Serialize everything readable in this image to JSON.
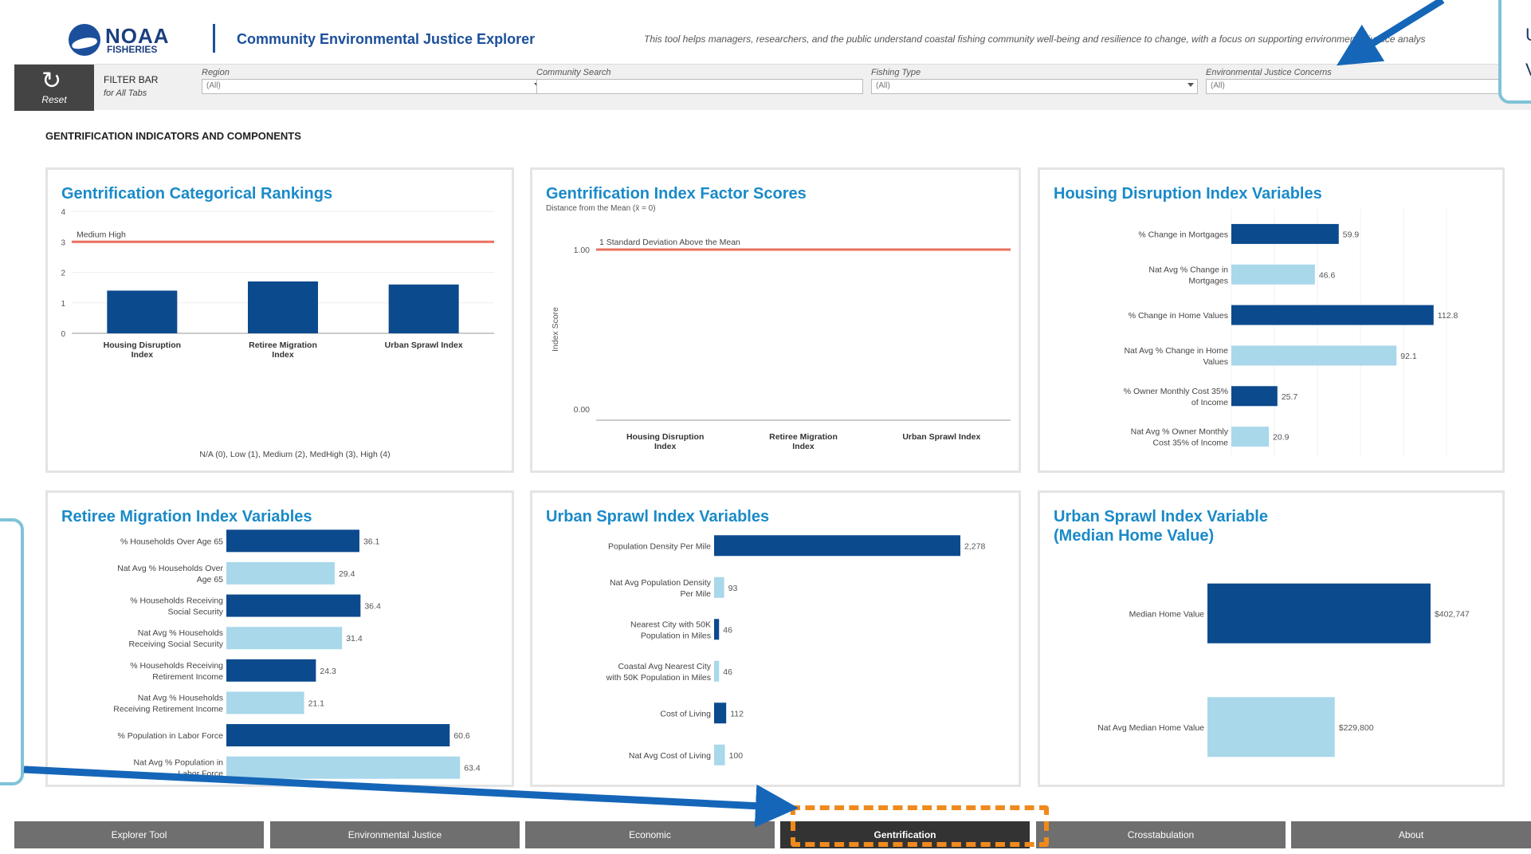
{
  "header": {
    "logo_main": "NOAA",
    "logo_sub": "FISHERIES",
    "app_title": "Community Environmental Justice Explorer",
    "description": "This tool helps managers, researchers, and the public understand coastal fishing community well-being and resilience to change, with a focus on supporting environmental justice analys"
  },
  "filterbar": {
    "reset_label": "Reset",
    "title": "FILTER BAR",
    "subtitle": "for All Tabs",
    "fields": [
      {
        "label": "Region",
        "value": "(All)",
        "dropdown": true
      },
      {
        "label": "Community Search",
        "value": "",
        "dropdown": false
      },
      {
        "label": "Fishing Type",
        "value": "(All)",
        "dropdown": true
      },
      {
        "label": "Environmental Justice Concerns",
        "value": "(All)",
        "dropdown": false
      }
    ]
  },
  "section_title": "GENTRIFICATION INDICATORS AND COMPONENTS",
  "panels": {
    "rankings": {
      "title": "Gentrification Categorical Rankings",
      "reference_label": "Medium High",
      "footnote": "N/A (0), Low (1), Medium (2), MedHigh (3), High (4)"
    },
    "factor_scores": {
      "title": "Gentrification Index Factor Scores",
      "subtitle": "Distance from the Mean (x̄ = 0)",
      "reference_label": "1 Standard Deviation Above the Mean",
      "ylabel": "Index Score"
    },
    "housing": {
      "title": "Housing Disruption Index Variables"
    },
    "retiree": {
      "title": "Retiree Migration Index Variables"
    },
    "sprawl": {
      "title": "Urban Sprawl Index Variables"
    },
    "median_home": {
      "title": "Urban Sprawl Index Variable (Median Home Value)"
    }
  },
  "tabs": [
    {
      "label": "Explorer Tool",
      "active": false
    },
    {
      "label": "Environmental Justice",
      "active": false
    },
    {
      "label": "Economic",
      "active": false
    },
    {
      "label": "Gentrification",
      "active": true
    },
    {
      "label": "Crosstabulation",
      "active": false
    },
    {
      "label": "About",
      "active": false
    }
  ],
  "annotations": {
    "top_right_text": [
      "U",
      "V"
    ]
  },
  "colors": {
    "dark_bar": "#0c4a8e",
    "light_bar": "#a8d8ea",
    "reference_line": "#e8715e",
    "title": "#1a8ac8",
    "highlight": "#f08a1c",
    "arrow": "#1566b8"
  },
  "chart_data": [
    {
      "id": "rankings",
      "type": "bar",
      "categories": [
        "Housing Disruption Index",
        "Retiree Migration Index",
        "Urban Sprawl Index"
      ],
      "values": [
        1.4,
        1.7,
        1.6
      ],
      "ylim": [
        0,
        4
      ],
      "yticks": [
        0,
        1,
        2,
        3,
        4
      ],
      "reference_line": 3
    },
    {
      "id": "factor_scores",
      "type": "bar",
      "categories": [
        "Housing Disruption Index",
        "Retiree Migration Index",
        "Urban Sprawl Index"
      ],
      "values": [
        0,
        0,
        0
      ],
      "yticks": [
        0.0,
        1.0
      ],
      "ytick_labels": [
        "0.00",
        "1.00"
      ],
      "reference_line": 1.0
    },
    {
      "id": "housing",
      "type": "bar",
      "orientation": "horizontal",
      "categories": [
        "% Change in Mortgages",
        "Nat Avg % Change in Mortgages",
        "% Change in Home Values",
        "Nat Avg % Change in Home Values",
        "% Owner Monthly Cost 35% of Income",
        "Nat Avg % Owner Monthly Cost 35% of Income"
      ],
      "values": [
        59.9,
        46.6,
        112.8,
        92.1,
        25.7,
        20.9
      ],
      "labels": [
        "59.9",
        "46.6",
        "112.8",
        "92.1",
        "25.7",
        "20.9"
      ],
      "xmax": 120
    },
    {
      "id": "retiree",
      "type": "bar",
      "orientation": "horizontal",
      "categories": [
        "% Households Over Age 65",
        "Nat Avg % Households Over Age 65",
        "% Households Receiving Social Security",
        "Nat Avg % Households Receiving Social Security",
        "% Households Receiving Retirement Income",
        "Nat Avg % Households Receiving Retirement Income",
        "% Population in Labor Force",
        "Nat Avg % Population in Labor Force"
      ],
      "values": [
        36.1,
        29.4,
        36.4,
        31.4,
        24.3,
        21.1,
        60.6,
        63.4
      ],
      "labels": [
        "36.1",
        "29.4",
        "36.4",
        "31.4",
        "24.3",
        "21.1",
        "60.6",
        "63.4"
      ],
      "xmax": 64
    },
    {
      "id": "sprawl",
      "type": "bar",
      "orientation": "horizontal",
      "categories": [
        "Population Density Per Mile",
        "Nat Avg Population Density Per Mile",
        "Nearest City with 50K Population in Miles",
        "Coastal Avg Nearest City with 50K Population in Miles",
        "Cost of Living",
        "Nat Avg Cost of Living"
      ],
      "values": [
        2278,
        93,
        46,
        46,
        112,
        100
      ],
      "labels": [
        "2,278",
        "93",
        "46",
        "46",
        "112",
        "100"
      ],
      "xmax": 2300
    },
    {
      "id": "median_home",
      "type": "bar",
      "orientation": "horizontal",
      "categories": [
        "Median Home Value",
        "Nat Avg Median Home Value"
      ],
      "values": [
        402747,
        229800
      ],
      "labels": [
        "$402,747",
        "$229,800"
      ],
      "xmax": 410000
    }
  ]
}
